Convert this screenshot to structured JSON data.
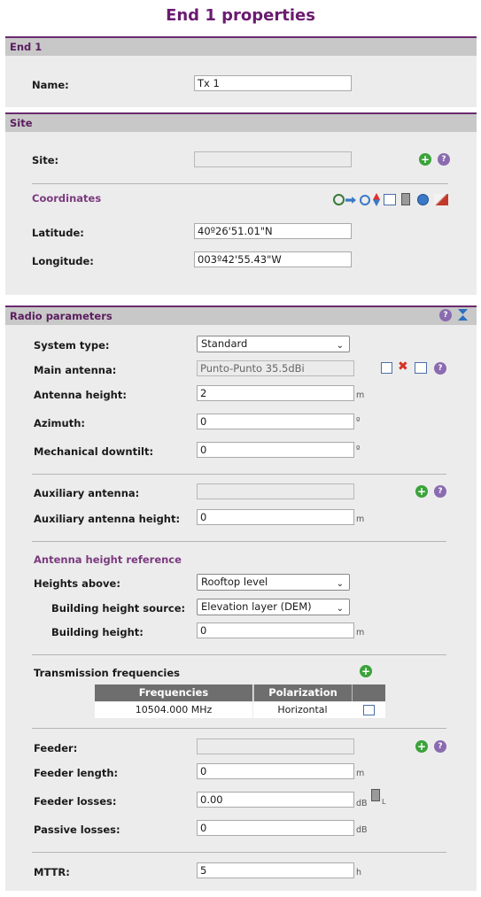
{
  "page_title": "End 1 properties",
  "end1": {
    "header": "End 1",
    "name_label": "Name:",
    "name_value": "Tx 1"
  },
  "site": {
    "header": "Site",
    "site_label": "Site:",
    "site_value": "",
    "coordinates_label": "Coordinates",
    "latitude_label": "Latitude:",
    "latitude_value": "40º26'51.01\"N",
    "longitude_label": "Longitude:",
    "longitude_value": "003º42'55.43\"W"
  },
  "radio": {
    "header": "Radio parameters",
    "system_type_label": "System type:",
    "system_type_value": "Standard",
    "main_antenna_label": "Main antenna:",
    "main_antenna_value": "Punto-Punto 35.5dBi",
    "antenna_height_label": "Antenna height:",
    "antenna_height_value": "2",
    "antenna_height_unit": "m",
    "azimuth_label": "Azimuth:",
    "azimuth_value": "0",
    "azimuth_unit": "º",
    "downtilt_label": "Mechanical downtilt:",
    "downtilt_value": "0",
    "downtilt_unit": "º",
    "aux_antenna_label": "Auxiliary antenna:",
    "aux_antenna_value": "",
    "aux_height_label": "Auxiliary antenna height:",
    "aux_height_value": "0",
    "aux_height_unit": "m",
    "height_ref_label": "Antenna height reference",
    "heights_above_label": "Heights above:",
    "heights_above_value": "Rooftop level",
    "bh_source_label": "Building height source:",
    "bh_source_value": "Elevation layer (DEM)",
    "building_height_label": "Building height:",
    "building_height_value": "0",
    "building_height_unit": "m",
    "tx_freq_label": "Transmission frequencies",
    "table": {
      "col_freq": "Frequencies",
      "col_pol": "Polarization",
      "row_freq": "10504.000 MHz",
      "row_pol": "Horizontal"
    },
    "feeder_label": "Feeder:",
    "feeder_value": "",
    "feeder_length_label": "Feeder length:",
    "feeder_length_value": "0",
    "feeder_length_unit": "m",
    "feeder_losses_label": "Feeder losses:",
    "feeder_losses_value": "0.00",
    "feeder_losses_unit": "dB",
    "passive_losses_label": "Passive losses:",
    "passive_losses_value": "0",
    "passive_losses_unit": "dB",
    "mttr_label": "MTTR:",
    "mttr_value": "5",
    "mttr_unit": "h"
  },
  "icons": {
    "add": "plus-circle-icon",
    "help": "help-icon",
    "collapse": "collapse-icon",
    "calc_unit": "L"
  }
}
